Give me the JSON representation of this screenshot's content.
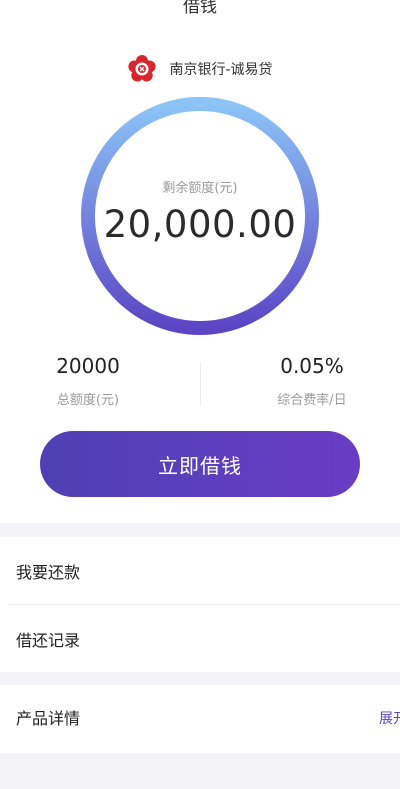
{
  "nav": {
    "title": "借钱"
  },
  "bank": {
    "name": "南京银行-诚易贷",
    "logo_icon": "bank-flower-logo-icon",
    "logo_color": "#d8262c"
  },
  "quota": {
    "remaining_label": "剩余额度(元)",
    "remaining_amount": "20,000.00",
    "ring_gradient": [
      "#8cc4f7",
      "#5b45c4"
    ]
  },
  "stats": {
    "total": {
      "value": "20000",
      "label": "总额度(元)"
    },
    "rate": {
      "value": "0.05%",
      "label": "综合费率/日"
    }
  },
  "actions": {
    "borrow_label": "立即借钱",
    "accent_color": "#5a3fbf"
  },
  "menu": {
    "items": [
      {
        "label": "我要还款"
      },
      {
        "label": "借还记录"
      }
    ]
  },
  "product": {
    "title": "产品详情",
    "expand_label": "展开"
  }
}
